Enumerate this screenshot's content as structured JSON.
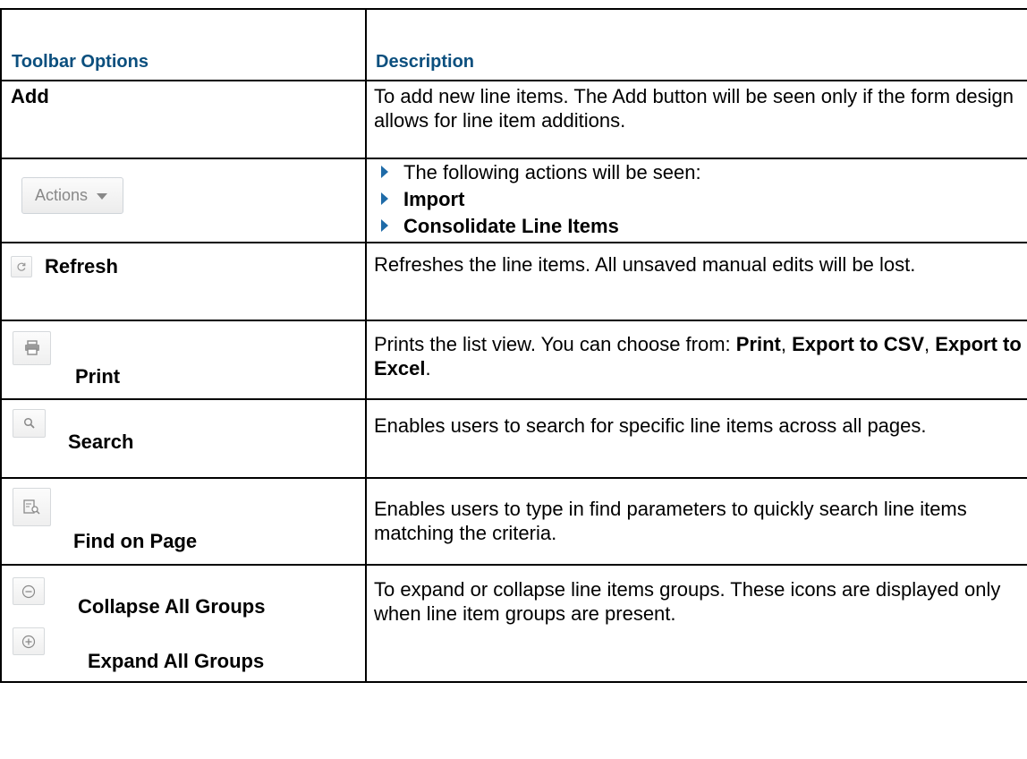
{
  "header": {
    "col1": "Toolbar Options",
    "col2": "Description"
  },
  "rows": [
    {
      "option": "Add",
      "desc": "To add new line items. The Add button will be seen only if the form design allows for line item additions."
    },
    {
      "button_label": "Actions",
      "bullets": [
        "The following actions will be seen:",
        "Import",
        "Consolidate Line Items"
      ]
    },
    {
      "option": "Refresh",
      "icon": "refresh-icon",
      "desc": "Refreshes the line items. All unsaved manual edits will be lost."
    },
    {
      "option": "Print",
      "icon": "print-icon",
      "desc_prefix": "Prints the list view. You can choose from: ",
      "opt1": "Print",
      "sep1": ", ",
      "opt2": "Export to CSV",
      "sep2": ", ",
      "opt3": "Export to Excel",
      "suffix": "."
    },
    {
      "option": "Search",
      "icon": "search-icon",
      "desc": "Enables users to search for specific line items across all pages."
    },
    {
      "option": "Find on Page",
      "icon": "find-on-page-icon",
      "desc": "Enables users to type in find parameters to quickly search line items matching the criteria."
    },
    {
      "option": "Collapse All Groups",
      "icon": "collapse-icon",
      "option2": "Expand All Groups",
      "icon2": "expand-icon",
      "desc": "To expand or collapse line items groups. These icons are displayed only when line item groups are present."
    }
  ]
}
